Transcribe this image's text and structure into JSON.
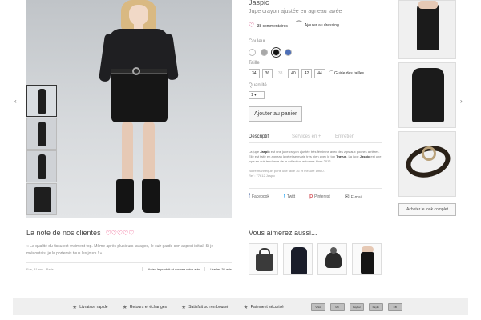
{
  "product": {
    "title": "Jaspic",
    "subtitle": "Jupe crayon ajustée en agneau lavée",
    "comments": "38 commentaires",
    "wardrobe": "Ajouter au dressing",
    "color_label": "Couleur",
    "colors": [
      "#ffffff",
      "#a8a8a8",
      "#111111",
      "#4d6fb8"
    ],
    "size_label": "Taille",
    "sizes": [
      "34",
      "36",
      "38",
      "40",
      "42",
      "44"
    ],
    "size_guide": "Guide des tailles",
    "qty_label": "Quantité",
    "qty_value": "1",
    "add_to_cart": "Ajouter au panier"
  },
  "tabs": [
    "Descriptif",
    "Services en +",
    "Entretien"
  ],
  "description": {
    "p1a": "La jupe ",
    "p1b": "Jaspic",
    "p1c": " est une jupe crayon ajustée très féminine avec des zips aux poches arrières. Elle est faite en agneau lavé et se marie très bien avec le top ",
    "p1d": "Trayun",
    "p1e": ". La jupe ",
    "p1f": "Jaspic",
    "p1g": " est une jupe en cuir tendance de la collection automne-hiver 2012.",
    "note": "Notre mannequin porte une taille 36 et mesure 1m80.",
    "ref": "Ref : 77612 Jaspic"
  },
  "share": {
    "facebook": "Facebook",
    "twitter": "Twitt",
    "pinterest": "Pinterest",
    "email": "E-mail"
  },
  "look_button": "Acheter le look complet",
  "reviews": {
    "title": "La note de nos clientes",
    "hearts": "♡♡♡♡♡",
    "text": "« La qualité du tissu est vraiment top. Même après plusieurs lavages, le cuir garde son aspect initial. Si je m'écoutais, je la porterais tous les jours ! »",
    "author": "Eve, 31 ans - Paris",
    "rate_button": "Notez le produit et donnez votre avis",
    "read_button": "Lire les 38 avis"
  },
  "suggestions": {
    "title": "Vous aimerez aussi..."
  },
  "footer": {
    "items": [
      "Livraison rapide",
      "Retours et échanges",
      "Satisfait ou remboursé",
      "Paiement sécurisé"
    ],
    "cards": [
      "VISA",
      "MC",
      "PayPal",
      "Paylib",
      "CB"
    ]
  },
  "icons": {
    "prev": "‹",
    "next": "›",
    "heart": "♡",
    "hanger": "⏜",
    "star": "★",
    "facebook": "f",
    "twitter": "t",
    "pinterest": "p",
    "email": "✉"
  }
}
